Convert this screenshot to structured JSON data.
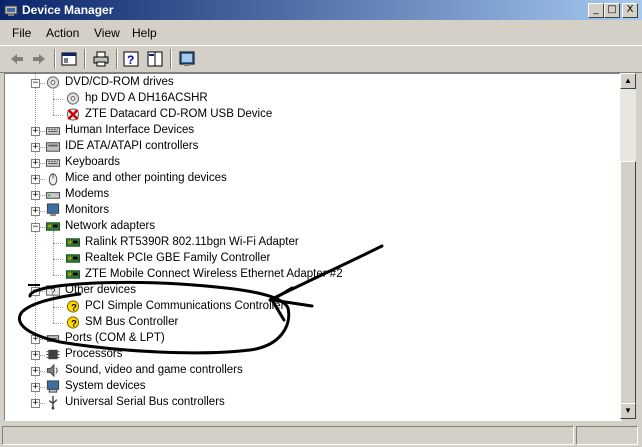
{
  "window": {
    "title": "Device Manager"
  },
  "caption_buttons": {
    "minimize": "_",
    "maximize": "□",
    "close": "X"
  },
  "menu": [
    "File",
    "Action",
    "View",
    "Help"
  ],
  "toolbar": {
    "items": [
      "back-icon",
      "forward-icon",
      "properties-icon",
      "print-icon",
      "help-icon",
      "view-icon",
      "scan-hardware-icon"
    ]
  },
  "tree": {
    "categories": [
      {
        "label": "DVD/CD-ROM drives",
        "expanded": true,
        "icon": "cdrom-drive-icon",
        "children": [
          {
            "label": "hp DVD A  DH16ACSHR",
            "icon": "cdrom-drive-icon"
          },
          {
            "label": "ZTE Datacard CD-ROM USB Device",
            "icon": "disabled-device-icon"
          }
        ]
      },
      {
        "label": "Human Interface Devices",
        "expanded": false,
        "icon": "keyboard-icon"
      },
      {
        "label": "IDE ATA/ATAPI controllers",
        "expanded": false,
        "icon": "controller-icon"
      },
      {
        "label": "Keyboards",
        "expanded": false,
        "icon": "keyboard-icon"
      },
      {
        "label": "Mice and other pointing devices",
        "expanded": false,
        "icon": "mouse-icon"
      },
      {
        "label": "Modems",
        "expanded": false,
        "icon": "modem-icon"
      },
      {
        "label": "Monitors",
        "expanded": false,
        "icon": "monitor-icon"
      },
      {
        "label": "Network adapters",
        "expanded": true,
        "icon": "network-card-icon",
        "children": [
          {
            "label": "Ralink RT5390R 802.11bgn Wi-Fi Adapter",
            "icon": "network-card-icon"
          },
          {
            "label": "Realtek PCIe GBE Family Controller",
            "icon": "network-card-icon"
          },
          {
            "label": "ZTE Mobile Connect Wireless Ethernet Adapter #2",
            "icon": "network-card-icon"
          }
        ]
      },
      {
        "label": "Other devices",
        "expanded": true,
        "icon": "unknown-device-icon",
        "children": [
          {
            "label": "PCI Simple Communications Controller",
            "icon": "warning-device-icon"
          },
          {
            "label": "SM Bus Controller",
            "icon": "warning-device-icon"
          }
        ]
      },
      {
        "label": "Ports (COM & LPT)",
        "expanded": false,
        "icon": "port-icon"
      },
      {
        "label": "Processors",
        "expanded": false,
        "icon": "processor-icon"
      },
      {
        "label": "Sound, video and game controllers",
        "expanded": false,
        "icon": "sound-icon"
      },
      {
        "label": "System devices",
        "expanded": false,
        "icon": "system-device-icon"
      },
      {
        "label": "Universal Serial Bus controllers",
        "expanded": false,
        "icon": "usb-icon"
      }
    ]
  },
  "annotation": {
    "description": "hand-drawn-circle-and-arrow"
  }
}
